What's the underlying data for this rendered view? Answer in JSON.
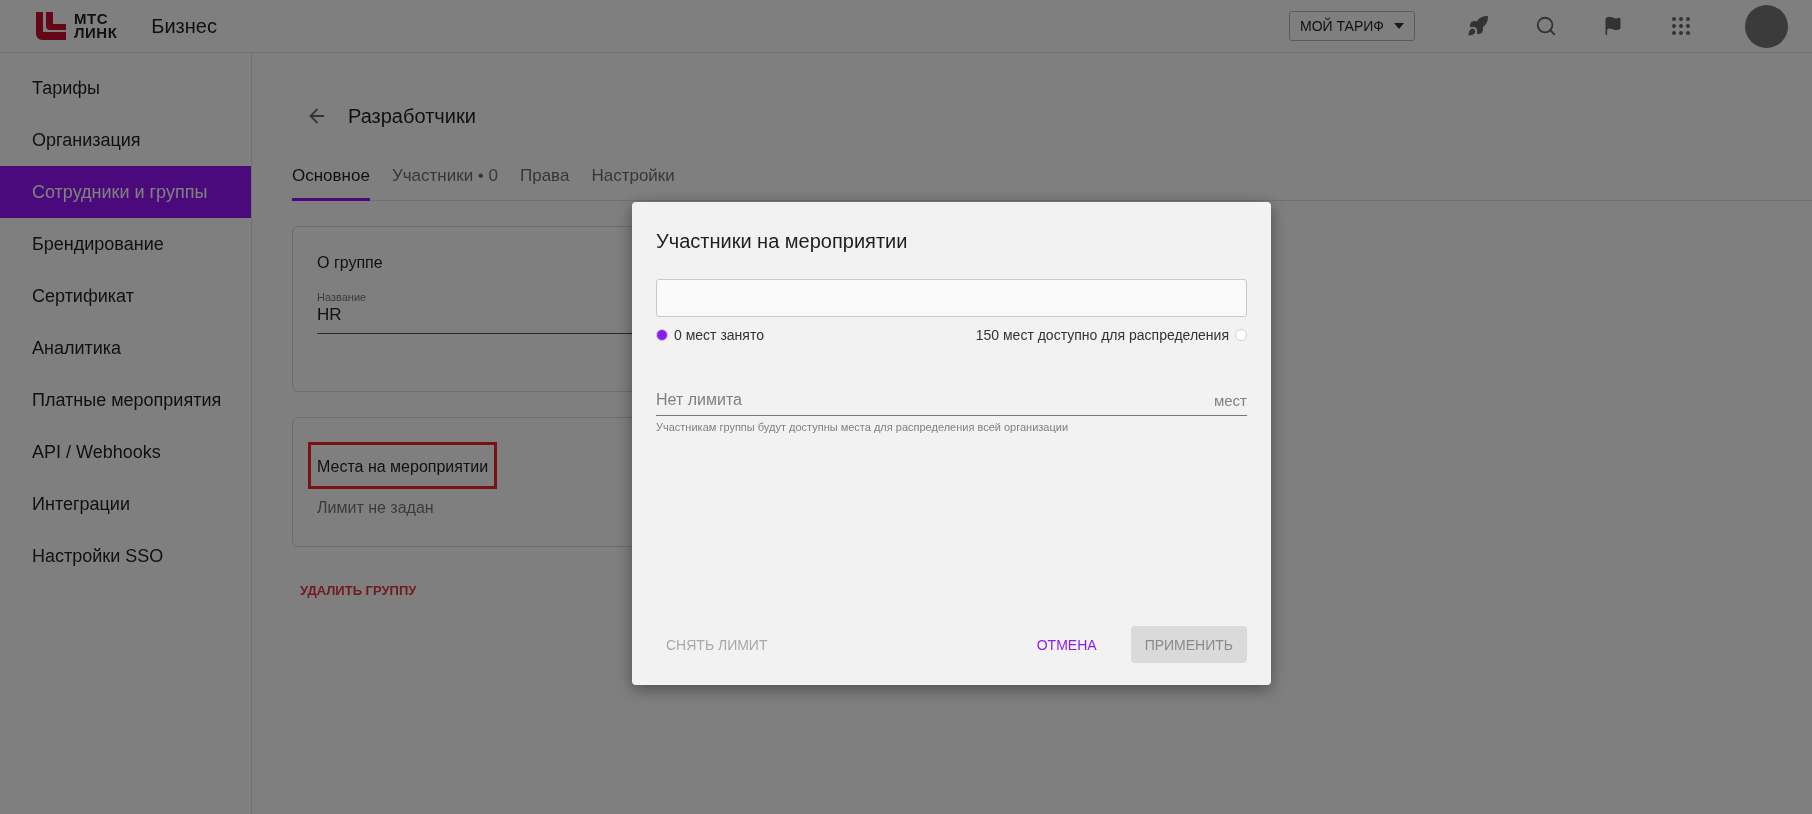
{
  "header": {
    "logo_lines": [
      "МТС",
      "ЛИНК"
    ],
    "product": "Бизнес",
    "plan_button": "МОЙ ТАРИФ"
  },
  "sidebar": {
    "items": [
      {
        "label": "Тарифы",
        "selected": false
      },
      {
        "label": "Организация",
        "selected": false
      },
      {
        "label": "Сотрудники и группы",
        "selected": true
      },
      {
        "label": "Брендирование",
        "selected": false
      },
      {
        "label": "Сертификат",
        "selected": false
      },
      {
        "label": "Аналитика",
        "selected": false
      },
      {
        "label": "Платные мероприятия",
        "selected": false
      },
      {
        "label": "API / Webhooks",
        "selected": false
      },
      {
        "label": "Интеграции",
        "selected": false
      },
      {
        "label": "Настройки SSO",
        "selected": false
      }
    ]
  },
  "page": {
    "title": "Разработчики",
    "tabs": [
      {
        "label": "Основное",
        "selected": true
      },
      {
        "label": "Участники • 0",
        "selected": false
      },
      {
        "label": "Права",
        "selected": false
      },
      {
        "label": "Настройки",
        "selected": false
      }
    ],
    "cards": [
      {
        "title": "О группе",
        "highlighted": false,
        "field_label": "Название",
        "field_value": "HR"
      },
      {
        "title": "Места на мероприятии",
        "highlighted": true,
        "note": "Лимит не задан"
      }
    ],
    "delete_link": "УДАЛИТЬ ГРУППУ"
  },
  "dialog": {
    "title": "Участники на мероприятии",
    "legend": [
      {
        "label": "0 мест занято",
        "color": "#8b1cf5"
      },
      {
        "label": "150 мест доступно для распределения",
        "color": "#ffffff"
      }
    ],
    "limit_field": {
      "placeholder": "Нет лимита",
      "suffix": "мест",
      "helper": "Участникам группы будут доступны места для распределения всей организации"
    },
    "buttons": [
      {
        "label": "СНЯТЬ ЛИМИТ",
        "kind": "text",
        "disabled": true
      },
      {
        "label": "ОТМЕНА",
        "kind": "text",
        "disabled": false
      },
      {
        "label": "ПРИМЕНИТЬ",
        "kind": "filled",
        "disabled": true
      }
    ]
  }
}
